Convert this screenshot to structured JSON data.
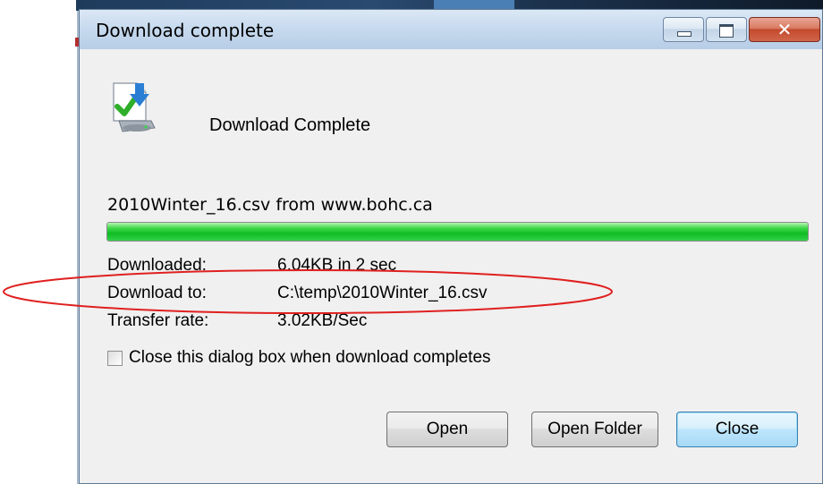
{
  "window": {
    "title": "Download complete",
    "controls": {
      "minimize": "minimize-icon",
      "maximize": "maximize-icon",
      "close": "close-icon"
    },
    "close_glyph": "✕"
  },
  "main": {
    "icon": "download-complete-icon",
    "heading": "Download Complete",
    "source": "2010Winter_16.csv from www.bohc.ca",
    "progress_percent": 100,
    "details": [
      {
        "label": "Downloaded:",
        "value": "6.04KB in 2 sec"
      },
      {
        "label": "Download to:",
        "value": "C:\\temp\\2010Winter_16.csv"
      },
      {
        "label": "Transfer rate:",
        "value": "3.02KB/Sec"
      }
    ],
    "checkbox": {
      "label": "Close this dialog box when download completes",
      "checked": false
    }
  },
  "buttons": {
    "open": "Open",
    "open_folder": "Open Folder",
    "close": "Close"
  },
  "colors": {
    "progress": "#1ec92f",
    "annotation": "#e02020",
    "default_button_border": "#3c7fb1"
  }
}
